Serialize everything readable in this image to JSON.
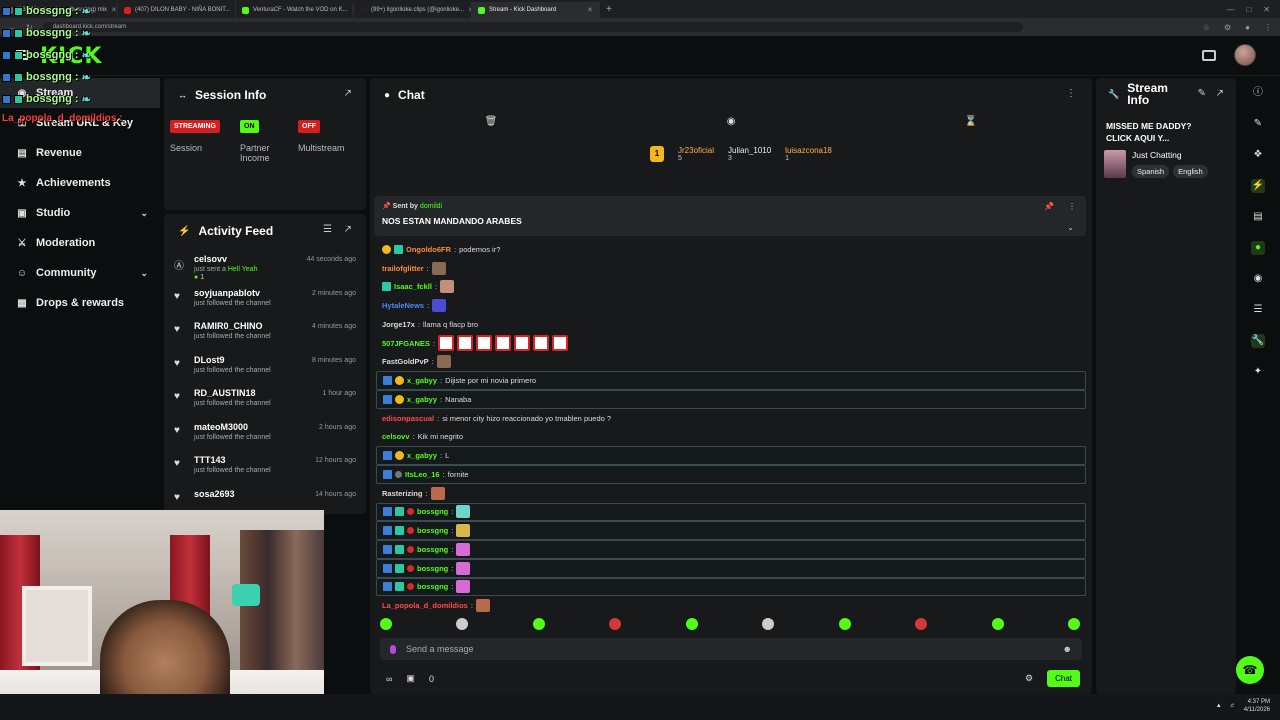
{
  "browser": {
    "tabs": [
      {
        "label": "(13) Whats — Ve... (bossgng) mix",
        "color": "#6a6a6a"
      },
      {
        "label": "(407) DILON BABY - NIÑA BONIT...",
        "color": "#e21b1b"
      },
      {
        "label": "VenturaCF - Watch the VOD on K...",
        "color": "#53fc18"
      },
      {
        "label": "(99+) ligonlioke.clips (@igonlioke...",
        "color": "#222222"
      },
      {
        "label": "Stream - Kick Dashboard",
        "color": "#53fc18",
        "active": true
      }
    ],
    "url": "dashboard.kick.com/stream"
  },
  "app": {
    "logo": "KICK"
  },
  "overlay": {
    "lines": [
      "bossgng :",
      "bossgng :",
      "bossgng :",
      "bossgng :",
      "bossgng :"
    ],
    "red_line": "La_popola_d_domildios :"
  },
  "sidebar": {
    "items": [
      {
        "label": "Stream",
        "icon": "broadcast-icon",
        "active": true
      },
      {
        "label": "Stream URL & Key",
        "icon": "key-icon"
      },
      {
        "label": "Revenue",
        "icon": "chart-icon"
      },
      {
        "label": "Achievements",
        "icon": "trophy-icon"
      },
      {
        "label": "Studio",
        "icon": "studio-icon",
        "chevron": true
      },
      {
        "label": "Moderation",
        "icon": "sword-icon"
      },
      {
        "label": "Community",
        "icon": "people-icon",
        "chevron": true
      },
      {
        "label": "Drops & rewards",
        "icon": "gift-icon"
      }
    ]
  },
  "session": {
    "title": "Session Info",
    "cols": [
      {
        "pill": "STREAMING",
        "label": "Session",
        "color": "red"
      },
      {
        "pill": "ON",
        "label": "Partner Income",
        "color": "green"
      },
      {
        "pill": "OFF",
        "label": "Multistream",
        "color": "red"
      }
    ]
  },
  "activity": {
    "title": "Activity Feed",
    "items": [
      {
        "name": "celsovv",
        "sub": "just sent a",
        "highlight": "Hell Yeah",
        "time": "44 seconds ago",
        "gift": "1",
        "icon": "kick-icon"
      },
      {
        "name": "soyjuanpablotv",
        "sub": "just followed the channel",
        "time": "2 minutes ago",
        "icon": "heart-icon"
      },
      {
        "name": "RAMIR0_CHINO",
        "sub": "just followed the channel",
        "time": "4 minutes ago",
        "icon": "heart-icon"
      },
      {
        "name": "DLost9",
        "sub": "just followed the channel",
        "time": "8 minutes ago",
        "icon": "heart-icon"
      },
      {
        "name": "RD_AUSTIN18",
        "sub": "just followed the channel",
        "time": "1 hour ago",
        "icon": "heart-icon"
      },
      {
        "name": "mateoM3000",
        "sub": "just followed the channel",
        "time": "2 hours ago",
        "icon": "heart-icon"
      },
      {
        "name": "TTT143",
        "sub": "just followed the channel",
        "time": "12 hours ago",
        "icon": "heart-icon"
      },
      {
        "name": "sosa2693",
        "sub": "",
        "time": "14 hours ago",
        "icon": "heart-icon"
      }
    ]
  },
  "chat": {
    "title": "Chat",
    "leaders": [
      {
        "name": "Jr23oficial",
        "count": "5",
        "color": "orange"
      },
      {
        "name": "Julian_1010",
        "count": "3",
        "color": "white"
      },
      {
        "name": "luisazcona18",
        "count": "1",
        "color": "orange"
      }
    ],
    "pinned": {
      "by_label": "Sent by",
      "by_user": "domildi",
      "message": "NOS ESTAN MANDANDO ARABES"
    },
    "messages": [
      {
        "user": "Ongoldo6FR",
        "text": "podemos ir?",
        "color": "#ff8a3a",
        "badges": [
          "gold",
          "teal"
        ],
        "hl": false
      },
      {
        "user": "trailofglitter",
        "text": "",
        "color": "#ff8a3a",
        "emote": "e1",
        "hl": false
      },
      {
        "user": "Isaac_fckll",
        "text": "",
        "color": "#53fc18",
        "badges": [
          "teal"
        ],
        "emote": "e2",
        "hl": false
      },
      {
        "user": "HytaleNews",
        "text": "",
        "color": "#4a8aff",
        "emote": "e3",
        "hl": false
      },
      {
        "user": "Jorge17x",
        "text": "llama q flacp bro",
        "color": "#dddddd",
        "hl": false
      },
      {
        "user": "507JFGANES",
        "text": "",
        "color": "#53fc18",
        "emote": "e4",
        "emote_count": 7,
        "hl": false
      },
      {
        "user": "FastGoldPvP",
        "text": "",
        "color": "#dddddd",
        "emote": "e1",
        "hl": false
      },
      {
        "user": "x_gabyy",
        "text": "Dijiste por mi novia primero",
        "color": "#53fc18",
        "badges": [
          "blue",
          "gold"
        ],
        "hl": true
      },
      {
        "user": "x_gabyy",
        "text": "Nanaba",
        "color": "#53fc18",
        "badges": [
          "blue",
          "gold"
        ],
        "hl": true
      },
      {
        "user": "edisonpascual",
        "text": "si menor city hizo reaccionado yo tmablen puedo ?",
        "color": "#ff4a4a",
        "hl": false
      },
      {
        "user": "celsovv",
        "text": "Kik mi negrito",
        "color": "#53fc18",
        "hl": false
      },
      {
        "user": "x_gabyy",
        "text": "L",
        "color": "#53fc18",
        "badges": [
          "blue",
          "gold"
        ],
        "hl": true
      },
      {
        "user": "ItsLeo_16",
        "text": "fornite",
        "color": "#53fc18",
        "badges": [
          "blue",
          "grey"
        ],
        "hl": true
      },
      {
        "user": "Rasterizing",
        "text": "",
        "color": "#dddddd",
        "emote": "e5",
        "hl": false
      },
      {
        "user": "bossgng",
        "text": "",
        "color": "#53fc18",
        "badges": [
          "blue",
          "teal",
          "red"
        ],
        "emote": "e6",
        "hl": true
      },
      {
        "user": "bossgng",
        "text": "",
        "color": "#53fc18",
        "badges": [
          "blue",
          "teal",
          "red"
        ],
        "emote": "e7",
        "hl": true
      },
      {
        "user": "bossgng",
        "text": "",
        "color": "#53fc18",
        "badges": [
          "blue",
          "teal",
          "red"
        ],
        "emote": "e8",
        "hl": true
      },
      {
        "user": "bossgng",
        "text": "",
        "color": "#53fc18",
        "badges": [
          "blue",
          "teal",
          "red"
        ],
        "emote": "e8",
        "hl": true
      },
      {
        "user": "bossgng",
        "text": "",
        "color": "#53fc18",
        "badges": [
          "blue",
          "teal",
          "red"
        ],
        "emote": "e8",
        "hl": true
      },
      {
        "user": "La_popola_d_domildios",
        "text": "",
        "color": "#ff4a4a",
        "emote": "e5",
        "hl": false
      }
    ],
    "emote_bar": [
      "g",
      "w",
      "g",
      "r",
      "g",
      "w",
      "g",
      "r",
      "g",
      "g"
    ],
    "input_placeholder": "Send a message",
    "footer_count": "0",
    "send_label": "Chat"
  },
  "stream_info": {
    "title": "Stream Info",
    "message_line1": "MISSED ME DADDY?",
    "message_line2": "CLICK AQUI Y...",
    "category": "Just Chatting",
    "tags": [
      "Spanish",
      "English"
    ]
  },
  "taskbar": {
    "time": "4:37 PM",
    "date": "4/11/2026"
  },
  "colors": {
    "brand": "#53fc18",
    "panel": "#18191b",
    "background": "#0b0e0f"
  }
}
